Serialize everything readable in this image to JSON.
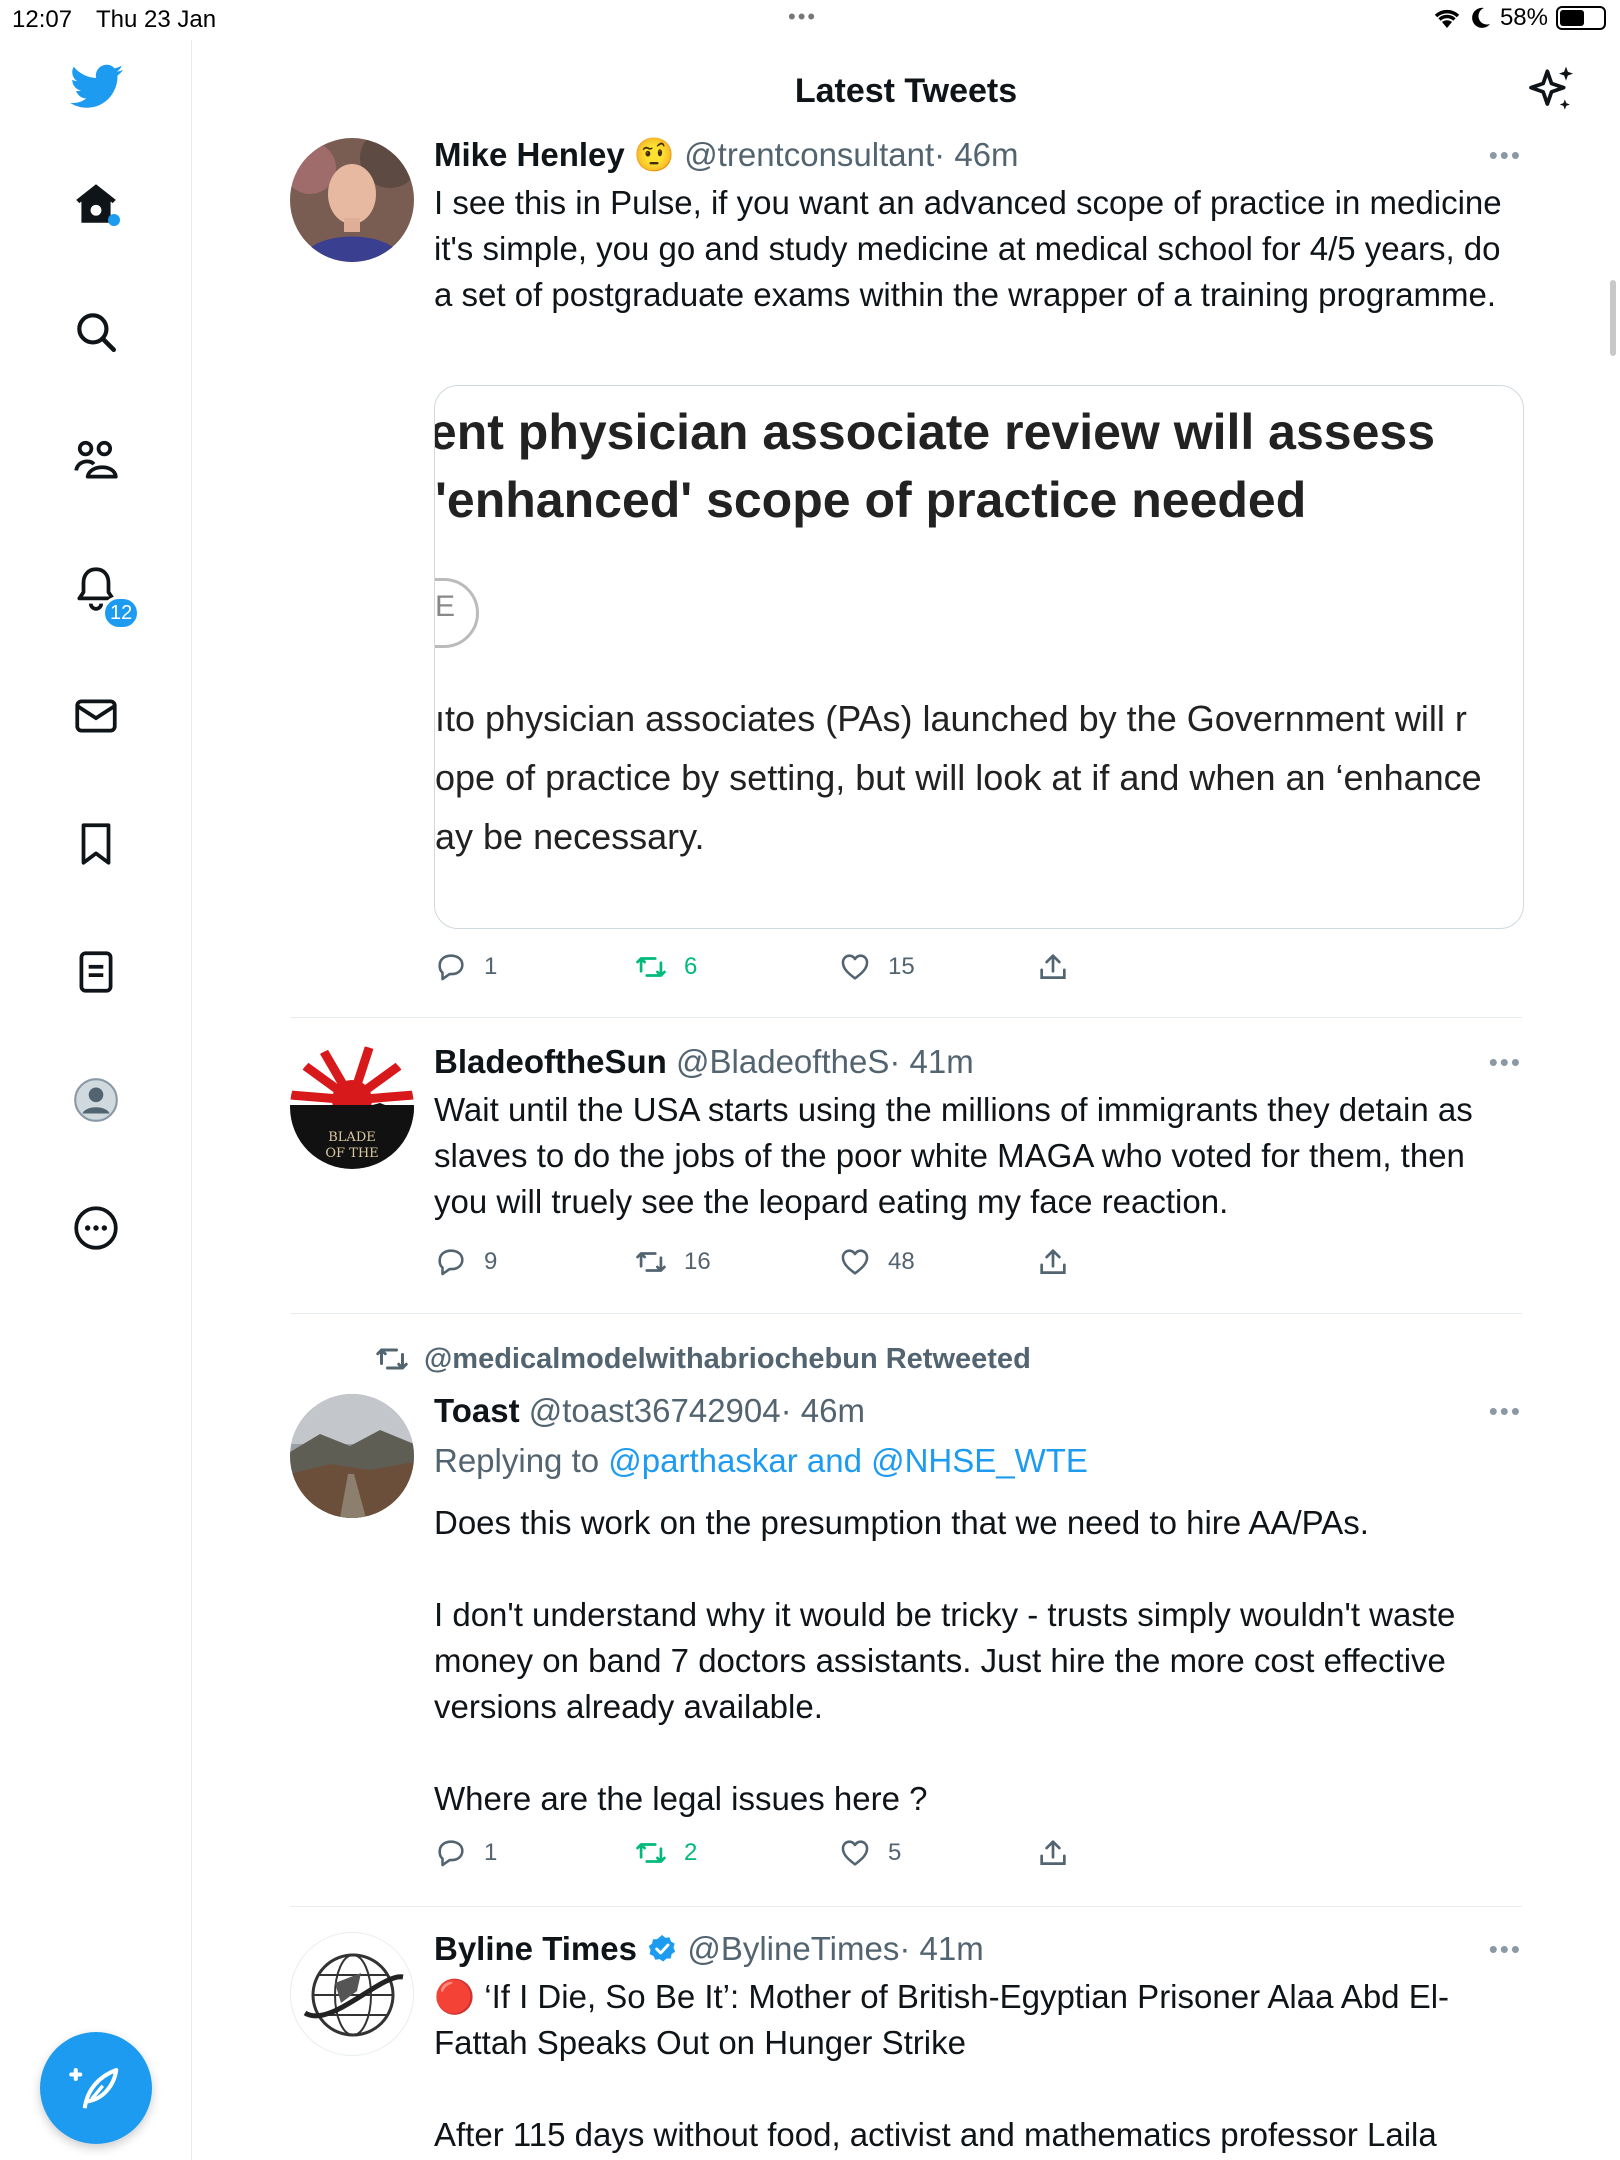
{
  "status_bar": {
    "time": "12:07",
    "date": "Thu 23 Jan",
    "battery": "58%",
    "battery_level": 0.58
  },
  "header": {
    "title": "Latest Tweets"
  },
  "sidebar": {
    "items": [
      {
        "name": "home",
        "icon": "home-icon"
      },
      {
        "name": "search",
        "icon": "search-icon"
      },
      {
        "name": "communities",
        "icon": "communities-icon"
      },
      {
        "name": "notifications",
        "icon": "bell-icon",
        "badge": "12"
      },
      {
        "name": "messages",
        "icon": "mail-icon"
      },
      {
        "name": "bookmarks",
        "icon": "bookmark-icon"
      },
      {
        "name": "lists",
        "icon": "list-icon"
      },
      {
        "name": "profile",
        "icon": "profile-icon"
      },
      {
        "name": "more",
        "icon": "more-icon"
      }
    ],
    "notification_badge": "12"
  },
  "colors": {
    "accent": "#1d9bf0",
    "retweet_green": "#00ba7c",
    "muted": "#536471"
  },
  "tweets": [
    {
      "name": "Mike Henley",
      "emoji": "🤨",
      "handle": "@trentconsultant",
      "time": "· 46m",
      "text": "I see this in Pulse, if you want an advanced scope of practice in medicine it's simple, you go and study medicine at medical school for 4/5 years, do a set of postgraduate exams within the wrapper of a training programme.",
      "card": {
        "heading_line1": "ıent physician associate review will assess",
        "heading_line2": "'enhanced' scope of practice needed",
        "circle_label": "E",
        "para_line1": "ıto physician associates (PAs) launched by the Government will r",
        "para_line2": "ope of practice by setting, but will look at if and when an ‘enhance",
        "para_line3": "ay be necessary."
      },
      "replies": "1",
      "retweets": "6",
      "likes": "15"
    },
    {
      "name": "BladeoftheSun",
      "handle": "@BladeoftheS",
      "time": "· 41m",
      "avatar_text": "BLADE OF THE",
      "text": "Wait until the USA starts using the millions of immigrants they detain as slaves to do the jobs of the poor white MAGA who voted for them, then you will truely see the leopard eating my face reaction.",
      "replies": "9",
      "retweets": "16",
      "likes": "48"
    },
    {
      "retweeted_by": "@medicalmodelwithabriochebun Retweeted",
      "name": "Toast",
      "handle": "@toast36742904",
      "time": "· 46m",
      "replying_prefix": "Replying to",
      "replying_to": "@parthaskar and @NHSE_WTE",
      "text": "Does this work on the presumption that we need to hire AA/PAs.\n\nI don't understand why it would be tricky - trusts simply wouldn't waste money on band 7 doctors assistants. Just hire the more cost effective versions already available.\n\nWhere are the legal issues here ?",
      "replies": "1",
      "retweets": "2",
      "likes": "5"
    },
    {
      "name": "Byline Times",
      "handle": "@BylineTimes",
      "time": "· 41m",
      "text": "🔴 ‘If I Die, So Be It’: Mother of British-Egyptian Prisoner Alaa Abd El-Fattah Speaks Out on Hunger Strike\n\nAfter 115 days without food, activist and mathematics professor Laila"
    }
  ],
  "more_glyph": "•••"
}
